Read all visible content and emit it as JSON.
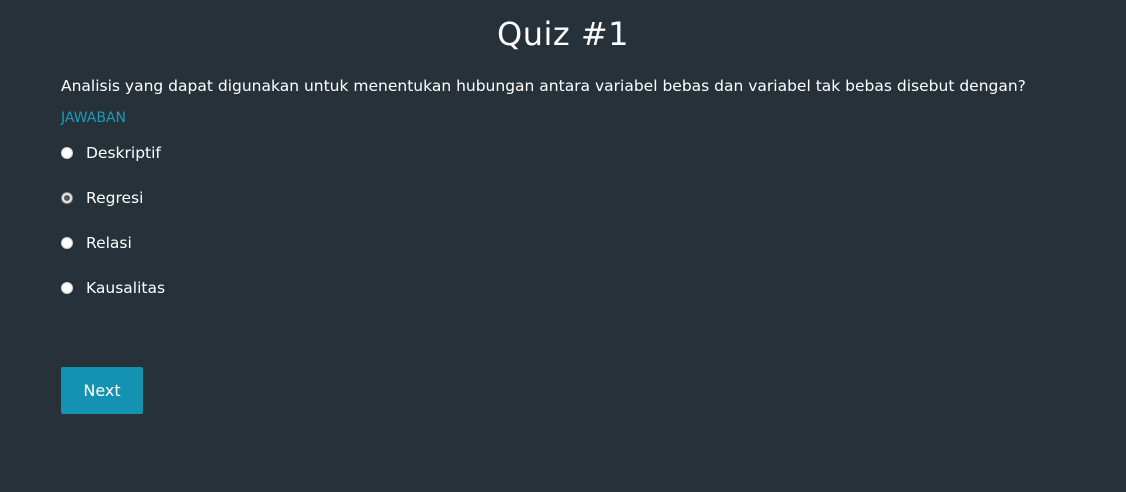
{
  "page": {
    "title": "Quiz #1"
  },
  "quiz": {
    "question": "Analisis yang dapat digunakan untuk menentukan hubungan antara variabel bebas dan variabel tak bebas disebut dengan?",
    "answer_label": "JAWABAN",
    "options": [
      {
        "label": "Deskriptif",
        "selected": false
      },
      {
        "label": "Regresi",
        "selected": true
      },
      {
        "label": "Relasi",
        "selected": false
      },
      {
        "label": "Kausalitas",
        "selected": false
      }
    ],
    "next_label": "Next"
  },
  "colors": {
    "background": "#263139",
    "accent": "#1591b2",
    "answer_label": "#1a9bb7",
    "text": "#ffffff"
  }
}
